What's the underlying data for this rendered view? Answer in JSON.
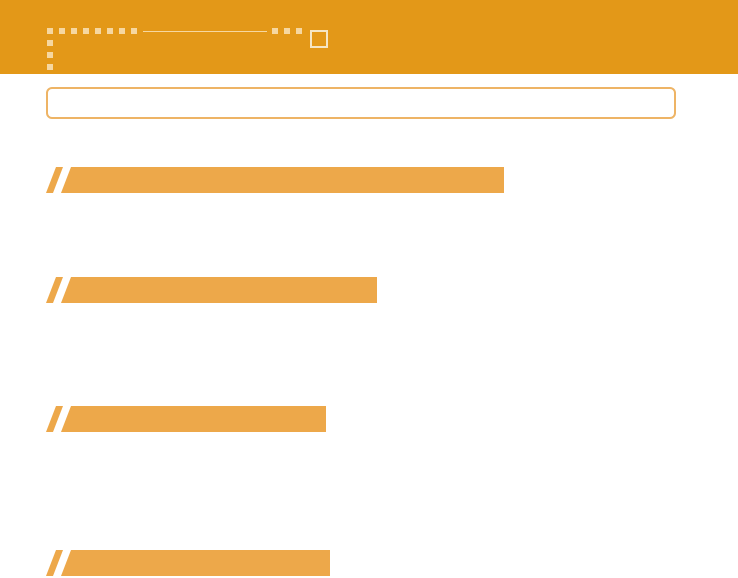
{
  "colors": {
    "header_background": "#e39818",
    "header_decoration": "#f6d7a0",
    "title_box_border": "#eeb465",
    "section_bar_fill": "#eda84a"
  },
  "header": {
    "icon": "square-outline-icon",
    "title": ""
  },
  "title_box": {
    "text": ""
  },
  "sections": [
    {
      "label": ""
    },
    {
      "label": ""
    },
    {
      "label": ""
    },
    {
      "label": ""
    }
  ]
}
